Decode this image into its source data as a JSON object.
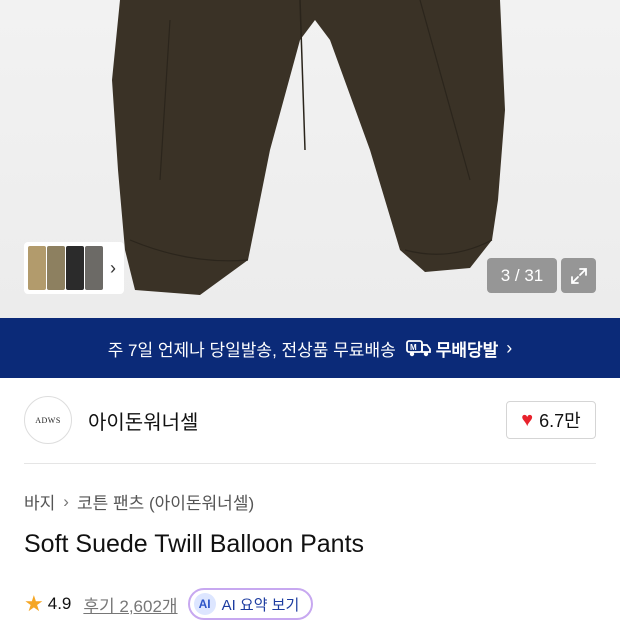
{
  "gallery": {
    "counter": "3 / 31",
    "thumbnail_count": 4
  },
  "banner": {
    "text": "주 7일 언제나 당일발송, 전상품 무료배송",
    "brand": "무배당발",
    "arrow": "›"
  },
  "store": {
    "logo_text": "ADWS",
    "name": "아이돈워너셀",
    "likes": "6.7만"
  },
  "breadcrumb": {
    "category": "바지",
    "separator": "›",
    "subcategory": "코튼 팬츠 (아이돈워너셀)"
  },
  "product": {
    "title": "Soft Suede Twill Balloon Pants"
  },
  "rating": {
    "score": "4.9",
    "reviews": "후기 2,602개",
    "ai_badge": "AI",
    "ai_label": "AI 요약 보기"
  },
  "colors": {
    "banner_bg": "#0b2a78",
    "heart": "#e8222c",
    "star": "#f5a623",
    "pants": "#3a3226"
  }
}
